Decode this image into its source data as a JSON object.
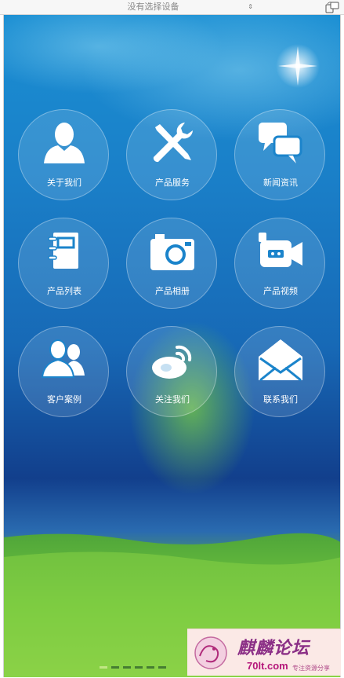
{
  "toolbar": {
    "device_select_value": "没有选择设备",
    "select_arrows": "⇕"
  },
  "menu": {
    "items": [
      {
        "label": "关于我们",
        "icon": "user-icon"
      },
      {
        "label": "产品服务",
        "icon": "tools-icon"
      },
      {
        "label": "新闻资讯",
        "icon": "chat-bubbles-icon"
      },
      {
        "label": "产品列表",
        "icon": "notebook-icon"
      },
      {
        "label": "产品相册",
        "icon": "camera-icon"
      },
      {
        "label": "产品视频",
        "icon": "video-camera-icon"
      },
      {
        "label": "客户案例",
        "icon": "users-icon"
      },
      {
        "label": "关注我们",
        "icon": "weibo-icon"
      },
      {
        "label": "联系我们",
        "icon": "envelope-icon"
      }
    ]
  },
  "pager": {
    "count": 6,
    "active_index": 0
  },
  "watermark": {
    "title": "麒麟论坛",
    "site": "70lt.com",
    "slogan": "专注资源分享"
  },
  "colors": {
    "tile_fill": "rgba(255,255,255,0.13)",
    "label": "#ffffff",
    "sky": "#1a7fc8",
    "grass": "#6fc33b",
    "watermark_text": "#8b2f86"
  }
}
